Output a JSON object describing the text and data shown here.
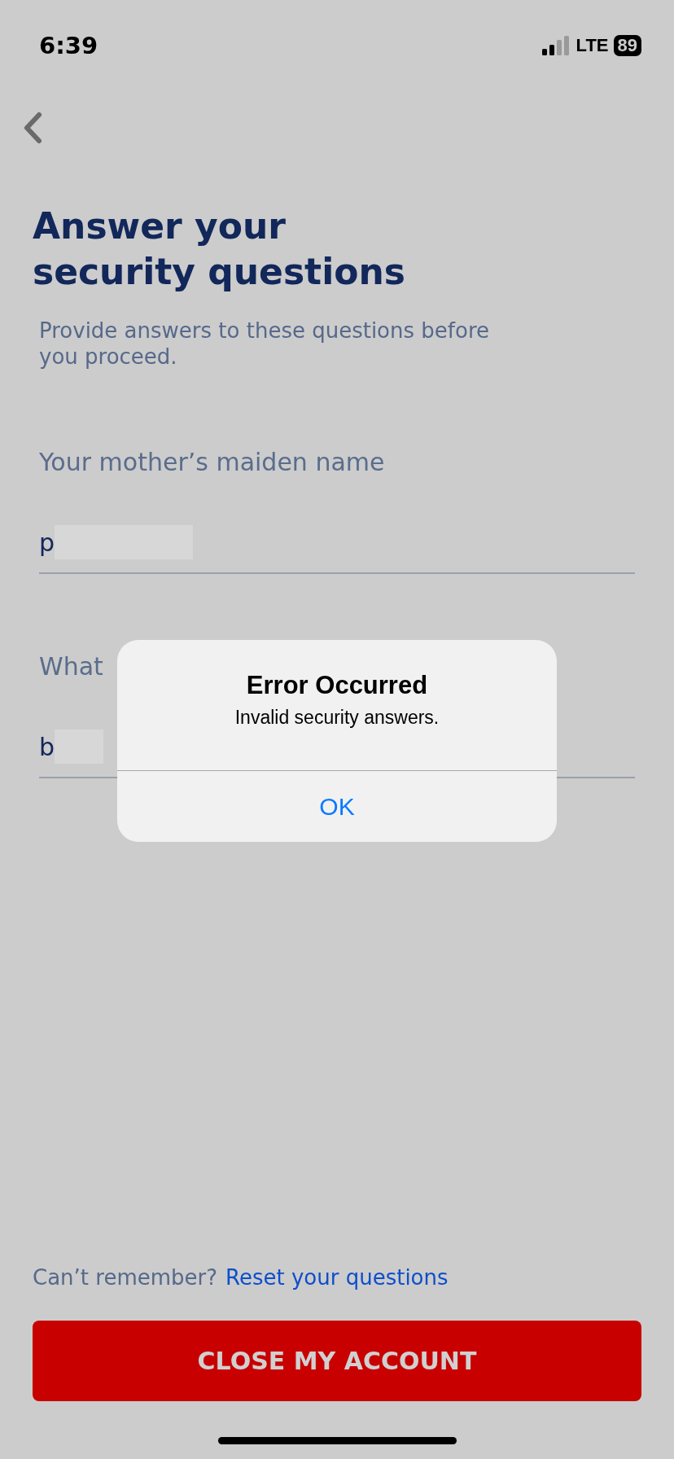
{
  "status_bar": {
    "time": "6:39",
    "network": "LTE",
    "battery": "89"
  },
  "title": "Answer your security questions",
  "subtitle": "Provide answers to these questions before you proceed.",
  "questions": [
    {
      "label": "Your mother’s maiden name",
      "value": "p"
    },
    {
      "label": "What",
      "value": "b"
    }
  ],
  "help": {
    "text": "Can’t remember?",
    "link": "Reset your questions"
  },
  "primary_button": "CLOSE MY ACCOUNT",
  "alert": {
    "title": "Error Occurred",
    "message": "Invalid security answers.",
    "button": "OK"
  }
}
